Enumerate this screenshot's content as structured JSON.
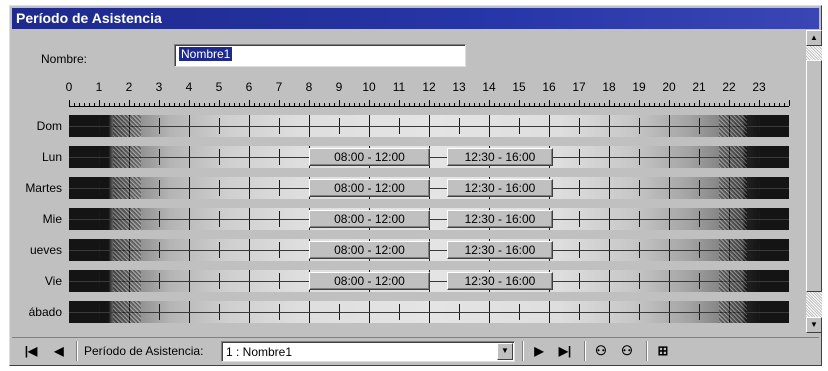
{
  "window": {
    "title": "Período de Asistencia"
  },
  "form": {
    "name_label": "Nombre:",
    "name_value": "Nombre1"
  },
  "hours": [
    "0",
    "1",
    "2",
    "3",
    "4",
    "5",
    "6",
    "7",
    "8",
    "9",
    "10",
    "11",
    "12",
    "13",
    "14",
    "15",
    "16",
    "17",
    "18",
    "19",
    "20",
    "21",
    "22",
    "23"
  ],
  "rows": [
    {
      "day": "Dom",
      "slots": []
    },
    {
      "day": "Lun",
      "slots": [
        "08:00 - 12:00",
        "12:30 - 16:00"
      ]
    },
    {
      "day": "Martes",
      "slots": [
        "08:00 - 12:00",
        "12:30 - 16:00"
      ]
    },
    {
      "day": "Mie",
      "slots": [
        "08:00 - 12:00",
        "12:30 - 16:00"
      ]
    },
    {
      "day": "ueves",
      "slots": [
        "08:00 - 12:00",
        "12:30 - 16:00"
      ]
    },
    {
      "day": "Vie",
      "slots": [
        "08:00 - 12:00",
        "12:30 - 16:00"
      ]
    },
    {
      "day": "ábado",
      "slots": []
    }
  ],
  "toolbar": {
    "first_icon": "first-record-icon",
    "prev_icon": "prev-record-icon",
    "label": "Período de Asistencia:",
    "selected": "1 : Nombre1",
    "next_icon": "next-record-icon",
    "last_icon": "last-record-icon",
    "find_icon": "binoculars-icon",
    "find_next_icon": "binoculars-next-icon",
    "new_icon": "new-record-icon"
  }
}
